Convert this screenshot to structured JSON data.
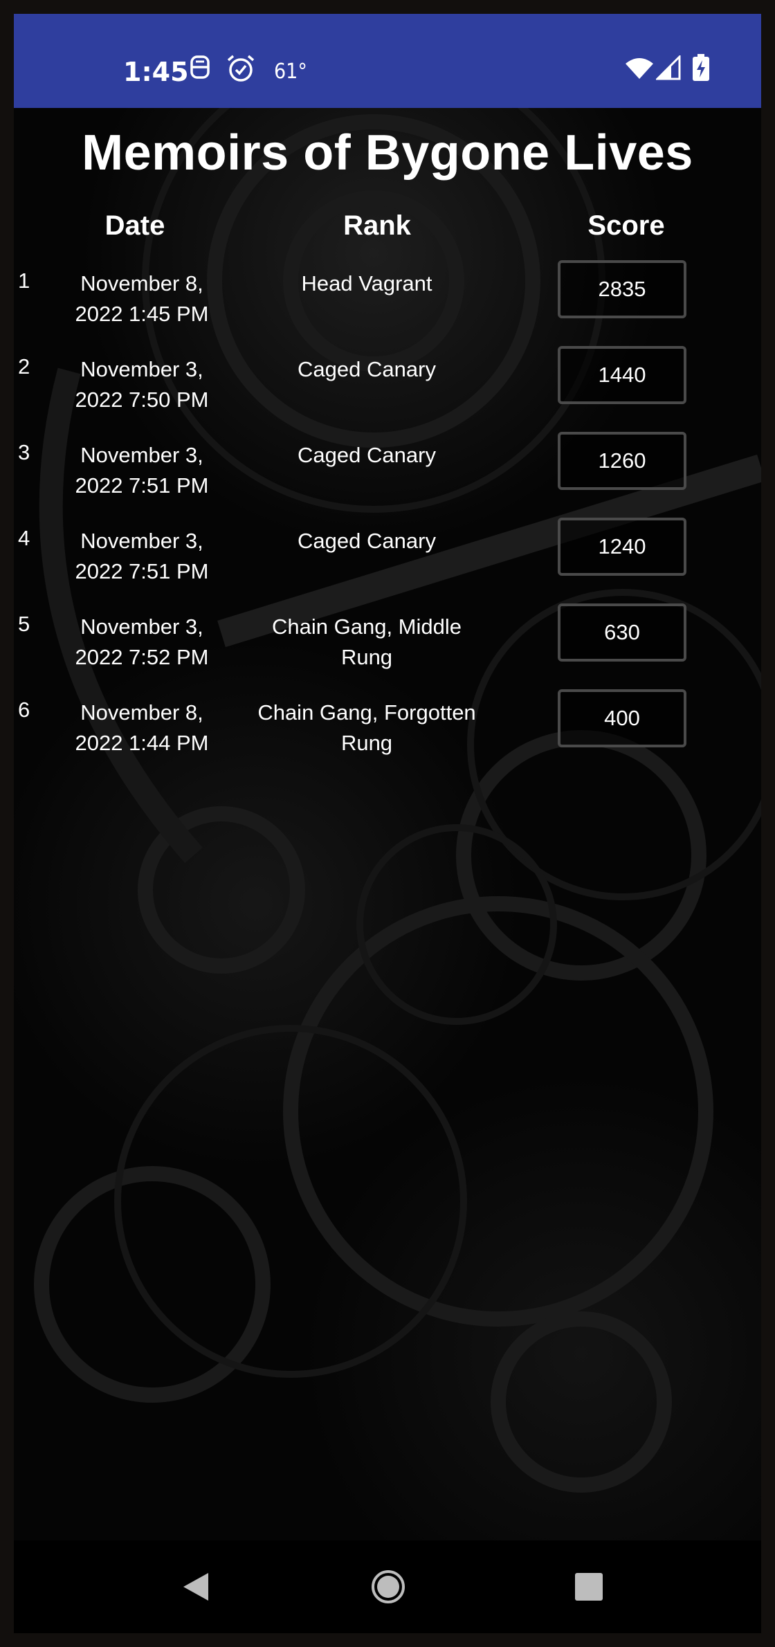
{
  "status_bar": {
    "time": "1:45",
    "temperature": "61°",
    "icons": [
      "notification-icon",
      "alarm-icon",
      "wifi-icon",
      "signal-icon",
      "battery-charging-icon"
    ]
  },
  "screen": {
    "title": "Memoirs of Bygone Lives",
    "columns": {
      "date": "Date",
      "rank": "Rank",
      "score": "Score"
    },
    "entries": [
      {
        "index": "1",
        "date_line1": "November 8,",
        "date_line2": "2022 1:45 PM",
        "rank_line1": "Head Vagrant",
        "rank_line2": "",
        "score": "2835"
      },
      {
        "index": "2",
        "date_line1": "November 3,",
        "date_line2": "2022 7:50 PM",
        "rank_line1": "Caged Canary",
        "rank_line2": "",
        "score": "1440"
      },
      {
        "index": "3",
        "date_line1": "November 3,",
        "date_line2": "2022 7:51 PM",
        "rank_line1": "Caged Canary",
        "rank_line2": "",
        "score": "1260"
      },
      {
        "index": "4",
        "date_line1": "November 3,",
        "date_line2": "2022 7:51 PM",
        "rank_line1": "Caged Canary",
        "rank_line2": "",
        "score": "1240"
      },
      {
        "index": "5",
        "date_line1": "November 3,",
        "date_line2": "2022 7:52 PM",
        "rank_line1": "Chain Gang, Middle",
        "rank_line2": "Rung",
        "score": "630"
      },
      {
        "index": "6",
        "date_line1": "November 8,",
        "date_line2": "2022 1:44 PM",
        "rank_line1": "Chain Gang, Forgotten",
        "rank_line2": "Rung",
        "score": "400"
      }
    ]
  },
  "nav_bar": {
    "buttons": [
      "back-icon",
      "home-icon",
      "recents-icon"
    ]
  },
  "colors": {
    "status_bar": "#2f3e9e",
    "background": "#050505",
    "text": "#ffffff",
    "score_border": "#4a4a4a"
  }
}
